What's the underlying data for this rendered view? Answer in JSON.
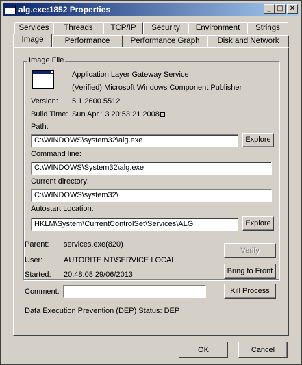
{
  "window": {
    "title": "alg.exe:1852 Properties",
    "buttons": {
      "minimize": "_",
      "maximize": "□",
      "close": "✕"
    }
  },
  "tabs": {
    "row1": [
      "Services",
      "Threads",
      "TCP/IP",
      "Security",
      "Environment",
      "Strings"
    ],
    "row2": [
      "Image",
      "Performance",
      "Performance Graph",
      "Disk and Network"
    ],
    "active": "Image"
  },
  "image_file": {
    "group_label": "Image File",
    "description": "Application Layer Gateway Service",
    "publisher": "(Verified) Microsoft Windows Component Publisher",
    "version_label": "Version:",
    "version": "5.1.2600.5512",
    "build_time_label": "Build Time:",
    "build_time": "Sun Apr 13 20:53:21 2008",
    "path_label": "Path:",
    "path": "C:\\WINDOWS\\system32\\alg.exe",
    "command_line_label": "Command line:",
    "command_line": "C:\\WINDOWS\\System32\\alg.exe",
    "current_directory_label": "Current directory:",
    "current_directory": "C:\\WINDOWS\\system32\\",
    "autostart_label": "Autostart Location:",
    "autostart": "HKLM\\System\\CurrentControlSet\\Services\\ALG",
    "explore_label": "Explore"
  },
  "process": {
    "parent_label": "Parent:",
    "parent": "services.exe(820)",
    "user_label": "User:",
    "user": "AUTORITE NT\\SERVICE LOCAL",
    "started_label": "Started:",
    "started": "20:48:08   29/06/2013",
    "comment_label": "Comment:",
    "comment": "",
    "dep_status": "Data Execution Prevention (DEP) Status: DEP"
  },
  "actions": {
    "verify": "Verify",
    "bring_to_front": "Bring to Front",
    "kill_process": "Kill Process"
  },
  "dialog": {
    "ok": "OK",
    "cancel": "Cancel"
  }
}
